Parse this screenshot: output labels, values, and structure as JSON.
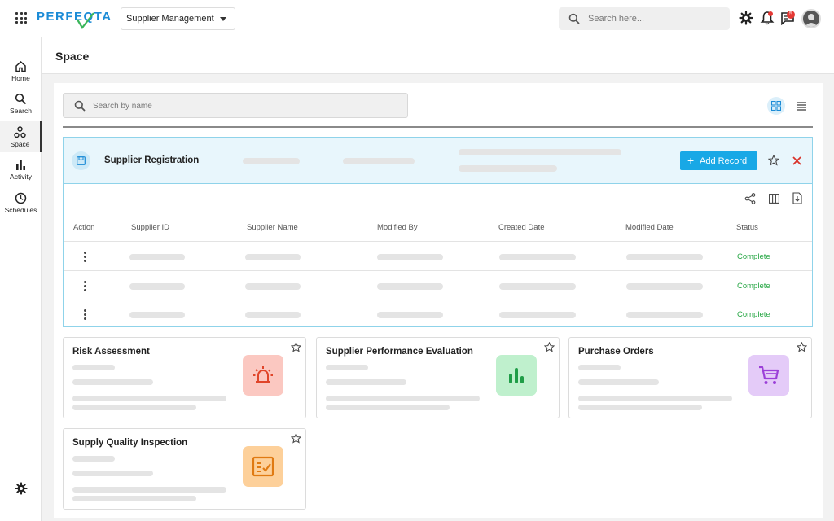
{
  "app": {
    "logo_text": "PERFEQTA",
    "module": "Supplier Management",
    "search_placeholder": "Search here...",
    "notification_count": "5"
  },
  "sidebar": {
    "items": [
      {
        "label": "Home",
        "icon": "home-icon"
      },
      {
        "label": "Search",
        "icon": "search-icon"
      },
      {
        "label": "Space",
        "icon": "space-icon",
        "active": true
      },
      {
        "label": "Activity",
        "icon": "bar-chart-icon"
      },
      {
        "label": "Schedules",
        "icon": "clock-icon"
      }
    ],
    "settings_icon": "gear-icon"
  },
  "page": {
    "title": "Space",
    "search_placeholder": "Search by name"
  },
  "record_panel": {
    "title": "Supplier Registration",
    "add_button": "Add Record",
    "columns": [
      "Action",
      "Supplier ID",
      "Supplier Name",
      "Modified By",
      "Created Date",
      "Modified Date",
      "Status"
    ],
    "rows": [
      {
        "status": "Complete"
      },
      {
        "status": "Complete"
      },
      {
        "status": "Complete"
      }
    ]
  },
  "cards": [
    {
      "title": "Risk Assessment",
      "icon": "alarm-icon",
      "color": "#fbc8c1"
    },
    {
      "title": "Supplier Performance Evaluation",
      "icon": "bar-chart-icon",
      "color": "#bff0cd"
    },
    {
      "title": "Purchase Orders",
      "icon": "cart-icon",
      "color": "#e4cbf8"
    },
    {
      "title": "Supply Quality Inspection",
      "icon": "checklist-icon",
      "color": "#fdd09a"
    }
  ],
  "colors": {
    "accent": "#18a8e6",
    "status_complete": "#27a745"
  }
}
